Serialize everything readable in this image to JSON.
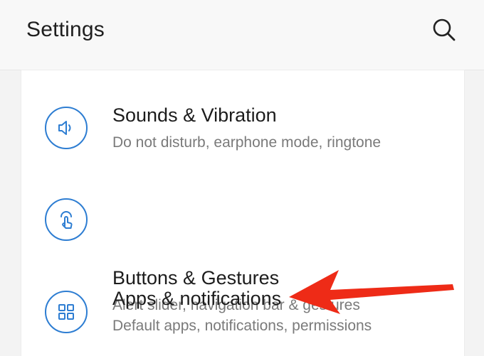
{
  "header": {
    "title": "Settings",
    "search_icon": "search-icon"
  },
  "settings_list": [
    {
      "title": "Sounds & Vibration",
      "subtitle": "Do not disturb, earphone mode, ringtone",
      "icon": "speaker-icon"
    },
    {
      "title": "Buttons & Gestures",
      "subtitle": "Alert slider, navigation bar & gestures",
      "icon": "touch-gesture-icon"
    },
    {
      "title": "Apps & notifications",
      "subtitle": "Default apps, notifications, permissions",
      "icon": "apps-grid-icon"
    }
  ],
  "colors": {
    "accent": "#2d7dd2",
    "annotation_arrow": "#ee2b17",
    "title_text": "#1c1c1c",
    "subtitle_text": "#7a7a7a"
  }
}
